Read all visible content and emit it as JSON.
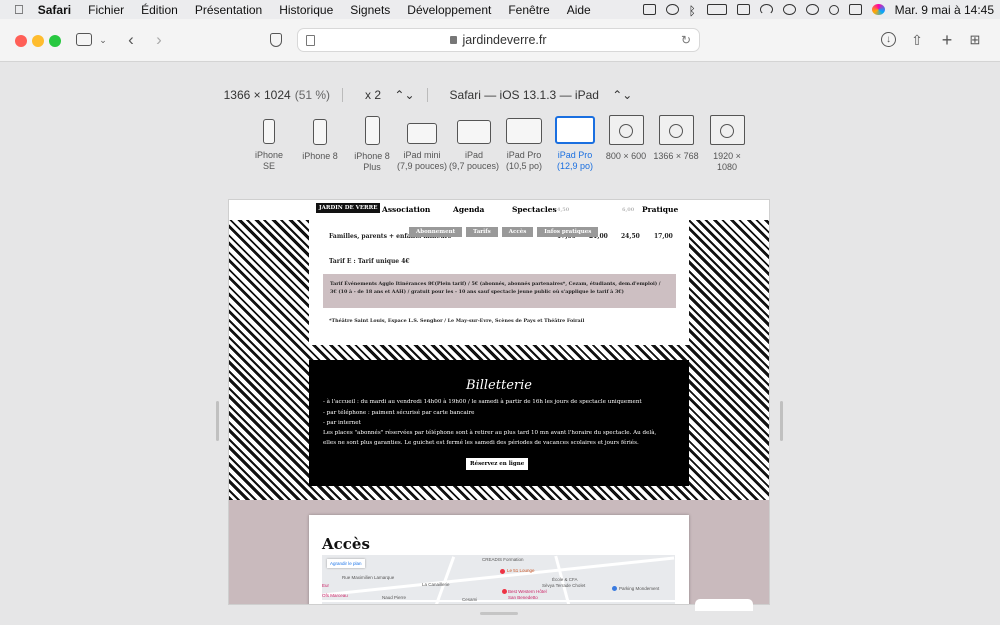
{
  "menubar": {
    "app": "Safari",
    "items": [
      "Fichier",
      "Édition",
      "Présentation",
      "Historique",
      "Signets",
      "Développement",
      "Fenêtre",
      "Aide"
    ],
    "clock": "Mar. 9 mai à 14:45"
  },
  "toolbar": {
    "url": "jardindeverre.fr",
    "back_icon": "chevron-left-icon",
    "forward_icon": "chevron-right-icon"
  },
  "responsive": {
    "size": "1366 × 1024",
    "zoom": "(51 %)",
    "scale": "x 2",
    "agent": "Safari — iOS 13.1.3 — iPad",
    "devices": [
      {
        "label": "iPhone SE",
        "label2": ""
      },
      {
        "label": "iPhone 8",
        "label2": ""
      },
      {
        "label": "iPhone 8",
        "label2": "Plus"
      },
      {
        "label": "iPad mini",
        "label2": "(7,9 pouces)"
      },
      {
        "label": "iPad",
        "label2": "(9,7 pouces)"
      },
      {
        "label": "iPad Pro",
        "label2": "(10,5 po)"
      },
      {
        "label": "iPad Pro",
        "label2": "(12,9 po)"
      },
      {
        "label": "800 × 600",
        "label2": ""
      },
      {
        "label": "1366 × 768",
        "label2": ""
      },
      {
        "label": "1920 × 1080",
        "label2": ""
      }
    ],
    "selected_device": "iPad Pro (12,9 po)",
    "accent": "#1a6fe0"
  },
  "site": {
    "nav": {
      "logo": "JARDIN DE VERRE",
      "items": [
        "Association",
        "Agenda",
        "Spectacles",
        "Pratique"
      ],
      "prices_behind": [
        "4,50",
        "6,00"
      ]
    },
    "tabs": [
      "Abonnement",
      "Tarifs",
      "Accès",
      "Infos pratiques"
    ],
    "tarif_row": {
      "label": "Familles, parents + enfants mineurs",
      "values": [
        "17,00",
        "21,00",
        "24,50",
        "17,00"
      ]
    },
    "tarif_e": "Tarif E : Tarif unique 4€",
    "tarif_evenements": {
      "line1": "Tarif Événements Agglo Itinérances 8€(Plein tarif) / 5€ (abonnés, abonnés partenaires*, Cezam, étudiants, dem.d'emploi) /",
      "line2": "3€ (10 à - de 18 ans et AAH) / gratuit pour les - 10 ans sauf spectacle jeune public où s'applique le tarif à 3€)"
    },
    "note": "*Théâtre Saint Louis, Espace L.S. Senghor / Le May-sur-Evre, Scènes de Pays et Théâtre Foirail",
    "billetterie": {
      "title": "Billetterie",
      "lines": [
        "- à l'accueil : du mardi au vendredi 14h00 à 19h00 / le samedi à partir de 16h les jours de spectacle uniquement",
        "- par téléphone : paiment sécurisé par carte bancaire",
        "- par internet",
        "Les places \"abonnés\" réservées par téléphone sont à retirer au plus tard 10 mn avant l'horaire du spectacle. Au delà,",
        "elles ne sont plus garanties. Le guichet est fermé les samedi des périodes de vacances scolaires et jours fériés."
      ],
      "button": "Réservez en ligne"
    },
    "acces": {
      "title": "Accès",
      "enlarge": "Agrandir le plan",
      "map_labels": [
        "CREADIS Formation",
        "Le 51 Lounge",
        "Rue Maximilien Lamarque",
        "La Canaillerie",
        "École & CFA",
        "Sèvya Terrade Cholet",
        "Best Western Hôtel",
        "San Benedetto",
        "Parking Mondement",
        "Naud Pierre",
        "Cesami",
        "Ofs Marceau",
        "Eur"
      ]
    }
  }
}
